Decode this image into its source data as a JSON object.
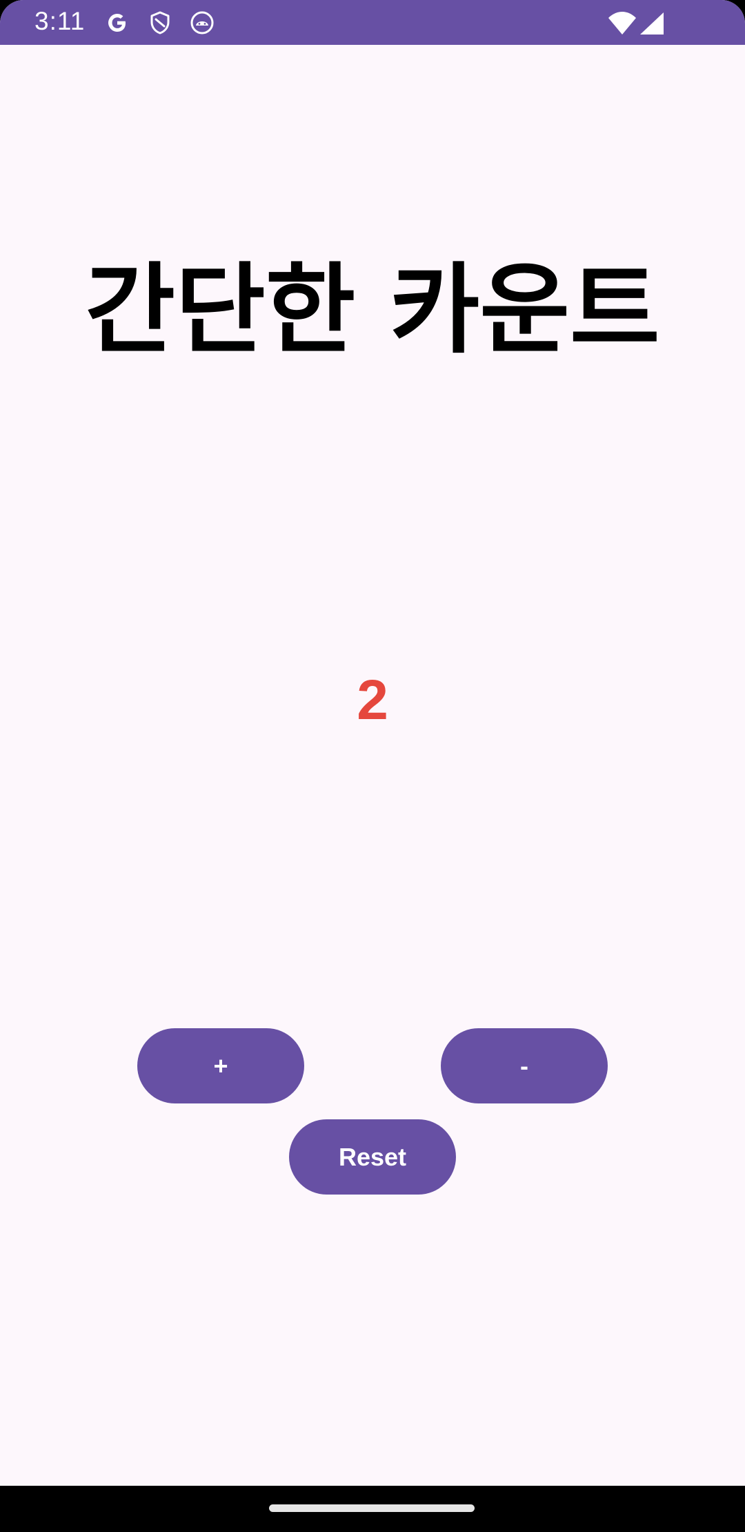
{
  "status_bar": {
    "time": "3:11",
    "left_icons": [
      "google-g-icon",
      "shield-icon",
      "android-face-icon"
    ],
    "right_icons": [
      "wifi-icon",
      "cell-signal-icon"
    ],
    "background_color": "#6750A4"
  },
  "main": {
    "title": "간단한 카운트",
    "count": "2",
    "count_color": "#E5473D"
  },
  "buttons": {
    "increment_label": "+",
    "decrement_label": "-",
    "reset_label": "Reset",
    "background_color": "#6750A4"
  },
  "colors": {
    "screen_background": "#FDF7FC",
    "accent": "#6750A4"
  }
}
